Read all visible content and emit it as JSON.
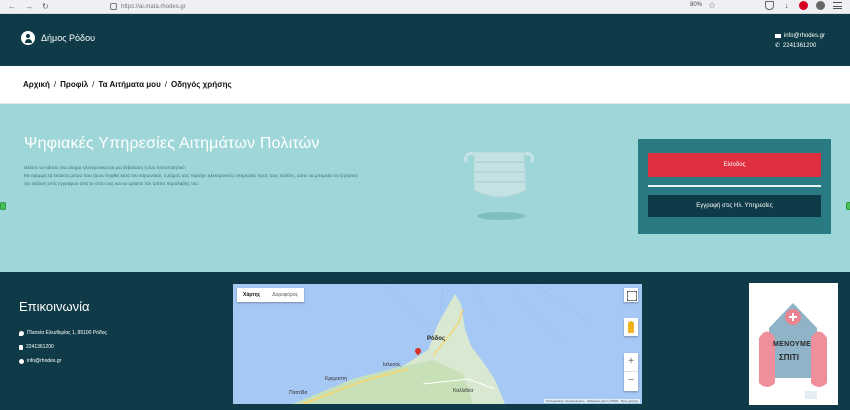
{
  "browser": {
    "url": "https://ai.mata.rhodes.gr",
    "zoom": "80%"
  },
  "header": {
    "brand": "Δήμος Ρόδου",
    "email": "info@rhodes.gr",
    "phone": "2241361200"
  },
  "breadcrumb": {
    "items": [
      "Αρχική",
      "Προφίλ",
      "Τα Αιτήματα μου",
      "Οδηγός χρήσης"
    ],
    "separator": "/"
  },
  "hero": {
    "title": "Ψηφιακές Υπηρεσίες Αιτημάτων Πολιτών",
    "text_line1": "Θέλετε να κάνετε ένα αίτημα ηλεκτρονικά και μια βεβαίωση ή ένα πιστοποιητικό;",
    "text_line2": "Με εφαρμή τα έκτακτα μέτρα που έχουν ληφθεί κατά του κορωνοϊού, ο Δήμος σας παρέχει ηλεκτρονικές υπηρεσίες προς τους πολίτες, ώστε να μπορείτε να ζητήσετε την έκδοση ενός εγγράφου από το σπίτι σας και να ορίσετε τον τρόπο παραλαβής του."
  },
  "login": {
    "login_label": "Είσοδος",
    "register_label": "Εγγραφή στις Ηλ. Υπηρεσίες"
  },
  "footer": {
    "title": "Επικοινωνία",
    "address": "Πλατεία Ελευθερίας 1, 85100 Ρόδος",
    "phone": "2241361200",
    "email": "info@rhodes.gr"
  },
  "map": {
    "tab_map": "Χάρτης",
    "tab_satellite": "Δορυφόρος",
    "city": "Ρόδος",
    "label_kremasti": "Κρεμαστή",
    "label_ialysos": "Ιαλυσός",
    "label_pastida": "Παστίδα",
    "label_kalithea": "Καλλιθέα",
    "zoom_in": "+",
    "zoom_out": "−",
    "attribution": "Συντομεύσεις πληκτρολογίου · Δεδομένα χάρτη ©2022 · Όροι χρήσης"
  },
  "poster": {
    "text_line1": "ΜΕΝΟΥΜΕ",
    "text_line2": "ΣΠΙΤΙ"
  },
  "colors": {
    "header_bg": "#0e3b47",
    "hero_bg": "#9fd6d8",
    "login_box_bg": "#2a7a83",
    "login_btn": "#e0303f"
  }
}
